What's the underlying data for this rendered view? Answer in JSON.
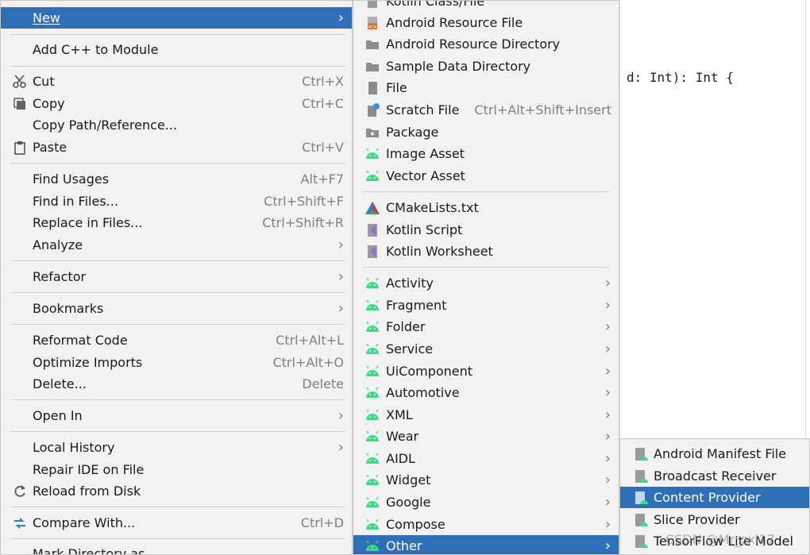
{
  "editor": {
    "code": "d: Int): Int {"
  },
  "menu1": [
    {
      "label": "New",
      "arrow": true,
      "selected": true
    },
    {
      "label": "Add C++ to Module"
    },
    {
      "label": "Cut",
      "shortcut": "Ctrl+X",
      "icon": "scissors-icon"
    },
    {
      "label": "Copy",
      "shortcut": "Ctrl+C",
      "icon": "copy-icon"
    },
    {
      "label": "Copy Path/Reference..."
    },
    {
      "label": "Paste",
      "shortcut": "Ctrl+V",
      "icon": "clipboard-icon"
    },
    {
      "label": "Find Usages",
      "shortcut": "Alt+F7"
    },
    {
      "label": "Find in Files...",
      "shortcut": "Ctrl+Shift+F"
    },
    {
      "label": "Replace in Files...",
      "shortcut": "Ctrl+Shift+R"
    },
    {
      "label": "Analyze",
      "arrow": true
    },
    {
      "label": "Refactor",
      "arrow": true
    },
    {
      "label": "Bookmarks",
      "arrow": true
    },
    {
      "label": "Reformat Code",
      "shortcut": "Ctrl+Alt+L"
    },
    {
      "label": "Optimize Imports",
      "shortcut": "Ctrl+Alt+O"
    },
    {
      "label": "Delete...",
      "shortcut": "Delete"
    },
    {
      "label": "Open In",
      "arrow": true
    },
    {
      "label": "Local History",
      "arrow": true
    },
    {
      "label": "Repair IDE on File"
    },
    {
      "label": "Reload from Disk",
      "icon": "reload-icon"
    },
    {
      "label": "Compare With...",
      "shortcut": "Ctrl+D",
      "icon": "compare-icon"
    },
    {
      "label": "Mark Directory as"
    }
  ],
  "menu2": [
    {
      "label": "Kotlin Class/File"
    },
    {
      "label": "Android Resource File"
    },
    {
      "label": "Android Resource Directory"
    },
    {
      "label": "Sample Data Directory"
    },
    {
      "label": "File"
    },
    {
      "label": "Scratch File",
      "shortcut": "Ctrl+Alt+Shift+Insert"
    },
    {
      "label": "Package"
    },
    {
      "label": "Image Asset"
    },
    {
      "label": "Vector Asset"
    },
    {
      "label": "CMakeLists.txt"
    },
    {
      "label": "Kotlin Script"
    },
    {
      "label": "Kotlin Worksheet"
    },
    {
      "label": "Activity",
      "arrow": true
    },
    {
      "label": "Fragment",
      "arrow": true
    },
    {
      "label": "Folder",
      "arrow": true
    },
    {
      "label": "Service",
      "arrow": true
    },
    {
      "label": "UiComponent",
      "arrow": true
    },
    {
      "label": "Automotive",
      "arrow": true
    },
    {
      "label": "XML",
      "arrow": true
    },
    {
      "label": "Wear",
      "arrow": true
    },
    {
      "label": "AIDL",
      "arrow": true
    },
    {
      "label": "Widget",
      "arrow": true
    },
    {
      "label": "Google",
      "arrow": true
    },
    {
      "label": "Compose",
      "arrow": true
    },
    {
      "label": "Other",
      "arrow": true,
      "selected": true
    }
  ],
  "menu3": [
    {
      "label": "Android Manifest File"
    },
    {
      "label": "Broadcast Receiver"
    },
    {
      "label": "Content Provider",
      "selected": true
    },
    {
      "label": "Slice Provider"
    },
    {
      "label": "TensorFlow Lite Model"
    }
  ],
  "watermark": "CSDN @Mr_zxl17",
  "colors": {
    "selection": "#2f6fb8",
    "android": "#3ddc84",
    "menu_bg": "#f2f2f2"
  }
}
